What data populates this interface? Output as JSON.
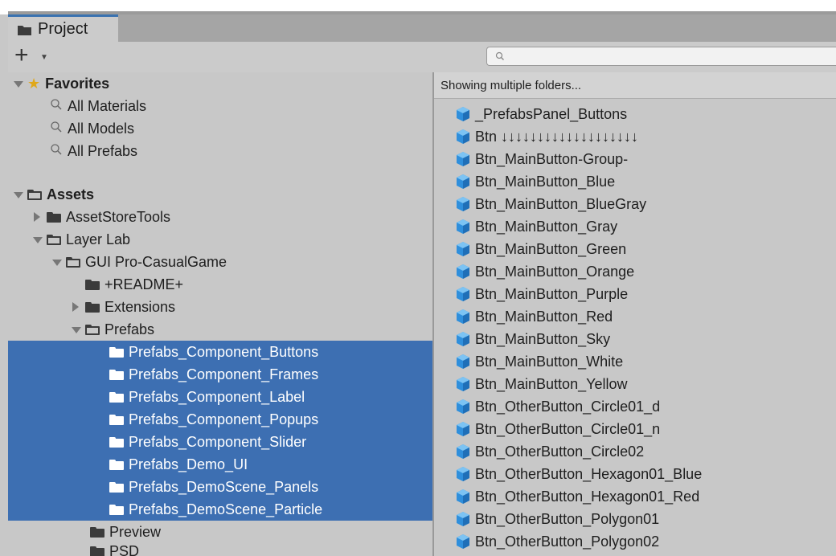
{
  "tab": {
    "label": "Project"
  },
  "search": {
    "placeholder": "",
    "value": ""
  },
  "favorites": {
    "label": "Favorites",
    "items": [
      "All Materials",
      "All Models",
      "All Prefabs"
    ]
  },
  "assets": {
    "label": "Assets",
    "asset_store_tools": "AssetStoreTools",
    "layer_lab": "Layer Lab",
    "gui_pro": "GUI Pro-CasualGame",
    "readme": "+README+",
    "extensions": "Extensions",
    "prefabs": "Prefabs",
    "prefab_folders": [
      "Prefabs_Component_Buttons",
      "Prefabs_Component_Frames",
      "Prefabs_Component_Label",
      "Prefabs_Component_Popups",
      "Prefabs_Component_Slider",
      "Prefabs_Demo_UI",
      "Prefabs_DemoScene_Panels",
      "Prefabs_DemoScene_Particle"
    ],
    "preview": "Preview",
    "psd": "PSD"
  },
  "right": {
    "header": "Showing multiple folders...",
    "items": [
      "_PrefabsPanel_Buttons",
      "Btn ↓↓↓↓↓↓↓↓↓↓↓↓↓↓↓↓↓↓↓",
      "Btn_MainButton-Group-",
      "Btn_MainButton_Blue",
      "Btn_MainButton_BlueGray",
      "Btn_MainButton_Gray",
      "Btn_MainButton_Green",
      "Btn_MainButton_Orange",
      "Btn_MainButton_Purple",
      "Btn_MainButton_Red",
      "Btn_MainButton_Sky",
      "Btn_MainButton_White",
      "Btn_MainButton_Yellow",
      "Btn_OtherButton_Circle01_d",
      "Btn_OtherButton_Circle01_n",
      "Btn_OtherButton_Circle02",
      "Btn_OtherButton_Hexagon01_Blue",
      "Btn_OtherButton_Hexagon01_Red",
      "Btn_OtherButton_Polygon01",
      "Btn_OtherButton_Polygon02"
    ]
  },
  "colors": {
    "selection": "#3d6fb2",
    "accent": "#3a72b0",
    "star": "#e0a81a",
    "cube": "#2f8fdc"
  }
}
